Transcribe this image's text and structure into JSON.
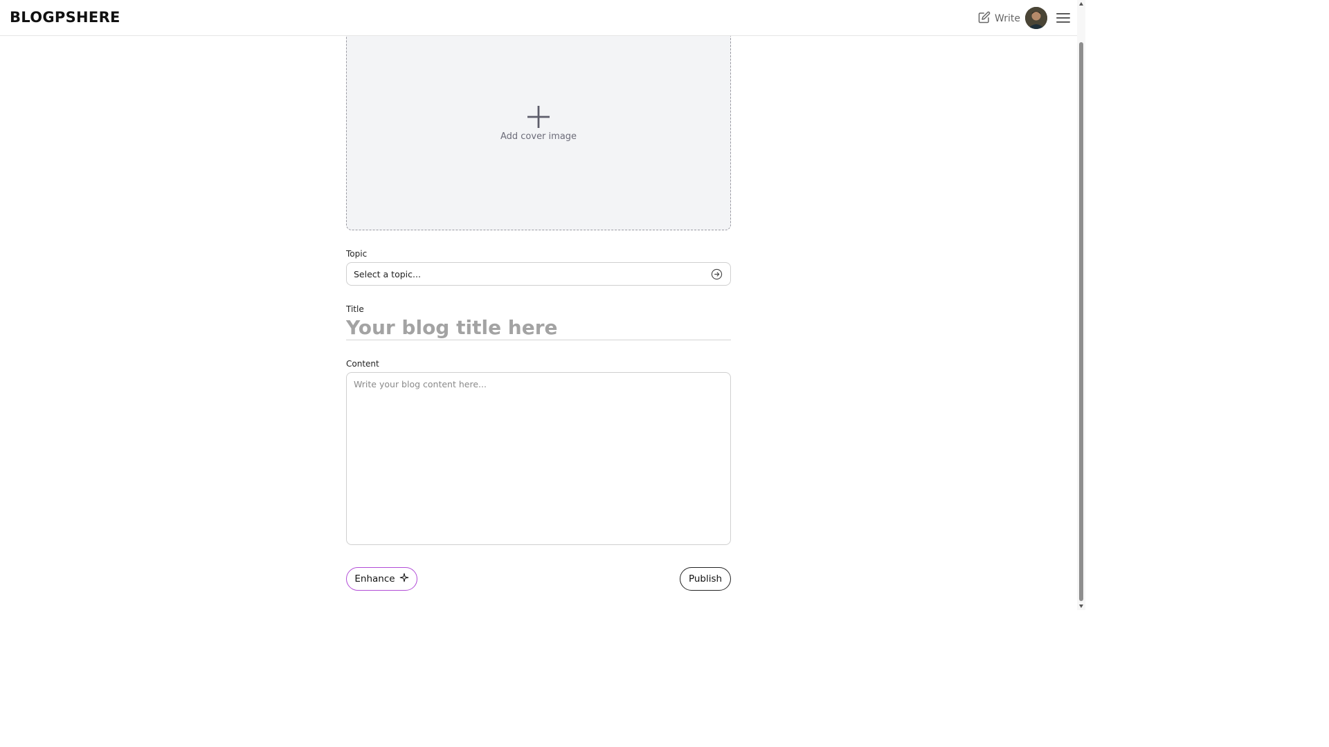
{
  "navbar": {
    "logo": "BLOGPSHERE",
    "write_label": "Write",
    "icons": {
      "write": "edit-pencil-icon",
      "avatar": "user-avatar",
      "menu": "hamburger-menu-icon"
    }
  },
  "editor": {
    "cover": {
      "label": "Add cover image",
      "icon": "plus-icon"
    },
    "topic": {
      "label": "Topic",
      "placeholder": "Select a topic...",
      "icon": "arrow-right-circle-icon"
    },
    "title": {
      "label": "Title",
      "placeholder": "Your blog title here"
    },
    "content": {
      "label": "Content",
      "placeholder": "Write your blog content here..."
    },
    "actions": {
      "enhance_label": "Enhance",
      "enhance_icon": "sparkle-icon",
      "publish_label": "Publish"
    }
  },
  "colors": {
    "enhance_border": "#b14bd6",
    "cover_bg": "#f3f4f6",
    "text": "#111111"
  }
}
